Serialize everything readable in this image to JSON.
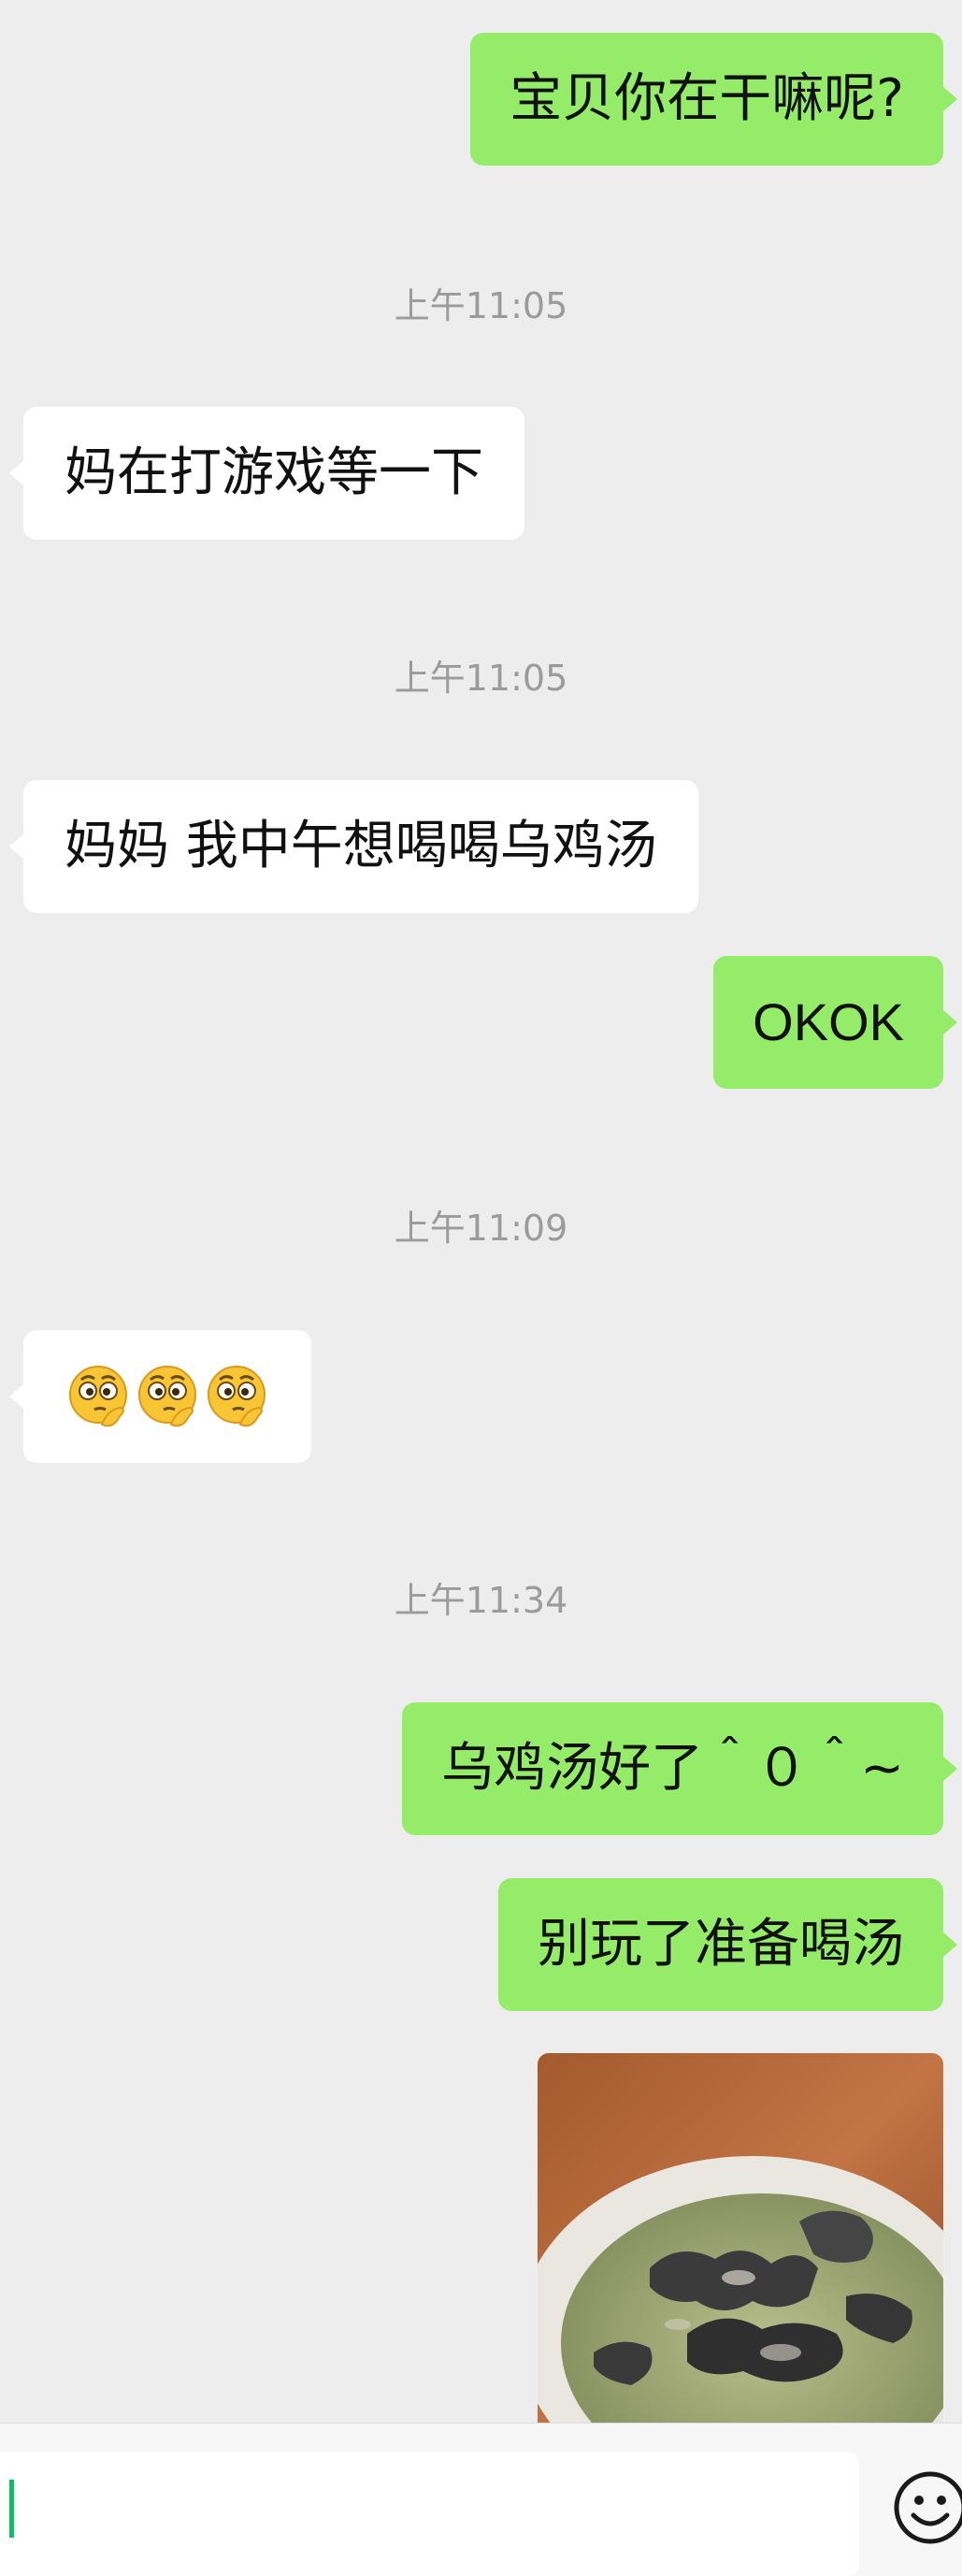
{
  "messages": [
    {
      "type": "outgoing",
      "text": "宝贝你在干嘛呢?"
    },
    {
      "type": "timestamp",
      "text": "上午11:05"
    },
    {
      "type": "incoming",
      "text": "妈在打游戏等一下"
    },
    {
      "type": "timestamp",
      "text": "上午11:05"
    },
    {
      "type": "incoming",
      "text": "妈妈 我中午想喝喝乌鸡汤"
    },
    {
      "type": "outgoing",
      "text": "OKOK"
    },
    {
      "type": "timestamp",
      "text": "上午11:09"
    },
    {
      "type": "incoming",
      "emoji": [
        "thinking-emoji",
        "thinking-emoji",
        "thinking-emoji"
      ]
    },
    {
      "type": "timestamp",
      "text": "上午11:34"
    },
    {
      "type": "outgoing",
      "text": "乌鸡汤好了＾０＾~"
    },
    {
      "type": "outgoing",
      "text": "别玩了准备喝汤"
    },
    {
      "type": "outgoing",
      "image": "black-chicken-soup-photo"
    }
  ],
  "input_bar": {
    "value": "",
    "emoji_button_icon": "smiley-icon"
  },
  "colors": {
    "background": "#ededed",
    "outgoing_bubble": "#95ec69",
    "incoming_bubble": "#ffffff",
    "timestamp_text": "#9b9b9b",
    "caret": "#07c160"
  }
}
